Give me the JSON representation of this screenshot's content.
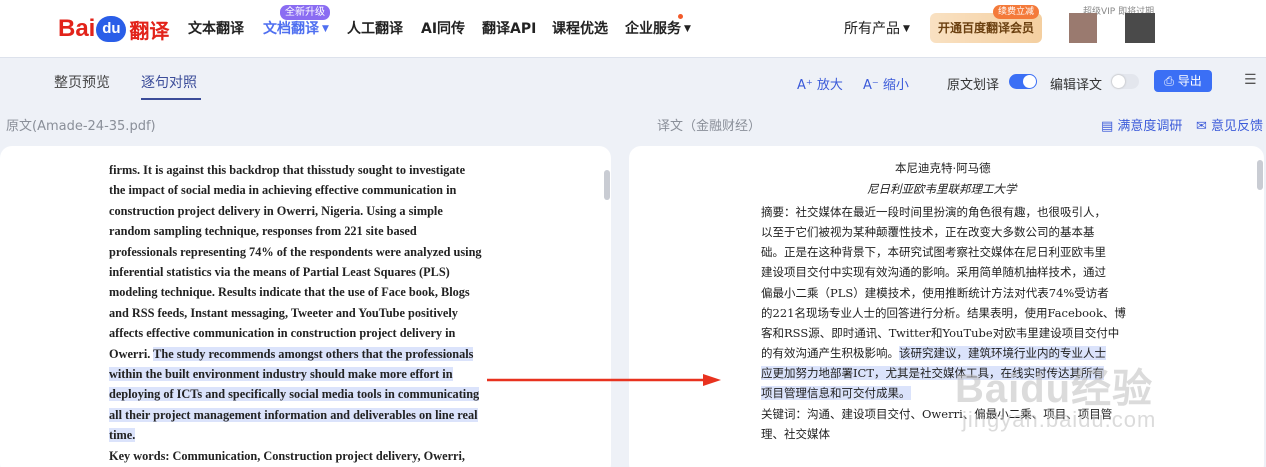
{
  "nav": {
    "logo_bai": "Bai",
    "logo_du": "du",
    "logo_fanyi": "翻译",
    "items": [
      "文本翻译",
      "文档翻译",
      "人工翻译",
      "AI同传",
      "翻译API",
      "课程优选",
      "企业服务"
    ],
    "new_badge": "全新升级",
    "all_products": "所有产品",
    "vip_button": "开通百度翻译会员",
    "vip_tag": "续费立减",
    "clipped_text": "超级VIP 即将过期"
  },
  "toolbar": {
    "tabs": [
      "整页预览",
      "逐句对照"
    ],
    "zoom_in": "A⁺ 放大",
    "zoom_out": "A⁻ 缩小",
    "source_highlight": "原文划译",
    "source_highlight_on": true,
    "edit_translation": "编辑译文",
    "edit_translation_on": false,
    "export": "导出"
  },
  "labels": {
    "source": "原文(Amade-24-35.pdf)",
    "target": "译文（金融财经）",
    "survey": "满意度调研",
    "feedback": "意见反馈"
  },
  "source_lines": [
    "firms. It is against this backdrop that thisstudy sought to investigate",
    "the impact of social media in achieving effective communication in",
    "construction project delivery in Owerri, Nigeria. Using a simple",
    "random sampling technique, responses from 221 site based",
    "professionals representing 74% of the respondents were analyzed using",
    "inferential statistics via the means of Partial Least Squares (PLS)",
    "modeling technique. Results indicate that the use of Face book, Blogs",
    "and RSS feeds, Instant messaging, Tweeter and YouTube positively",
    "affects effective communication in construction project delivery in"
  ],
  "source_mixed": {
    "plain": "Owerri. ",
    "highlight": "The study recommends amongst others that the professionals"
  },
  "source_highlight_lines": [
    "within the built environment industry should make more effort in",
    "deploying of ICTs and specifically social media tools in communicating",
    "all their project management information and deliverables on line real",
    "time."
  ],
  "source_keywords": "Key words: Communication, Construction project delivery, Owerri,",
  "target": {
    "author": "本尼迪克特·阿马德",
    "affiliation": "尼日利亚欧韦里联邦理工大学",
    "lines": [
      "摘要：社交媒体在最近一段时间里扮演的角色很有趣，也很吸引人，",
      "以至于它们被视为某种颠覆性技术，正在改变大多数公司的基本基",
      "础。正是在这种背景下，本研究试图考察社交媒体在尼日利亚欧韦里",
      "建设项目交付中实现有效沟通的影响。采用简单随机抽样技术，通过",
      "偏最小二乘（PLS）建模技术，使用推断统计方法对代表74%受访者",
      "的221名现场专业人士的回答进行分析。结果表明，使用Facebook、博",
      "客和RSS源、即时通讯、Twitter和YouTube对欧韦里建设项目交付中"
    ],
    "mixed_plain": "的有效沟通产生积极影响。",
    "mixed_highlight": "该研究建议，建筑环境行业内的专业人士",
    "highlight_lines": [
      "应更加努力地部署ICT，尤其是社交媒体工具，在线实时传达其所有",
      "项目管理信息和可交付成果。"
    ],
    "keywords_lines": [
      "关键词：沟通、建设项目交付、Owerri、偏最小二乘、项目、项目管",
      "理、社交媒体"
    ]
  },
  "watermark": {
    "text": "Baidu经验",
    "url": "jingyan.baidu.com"
  }
}
